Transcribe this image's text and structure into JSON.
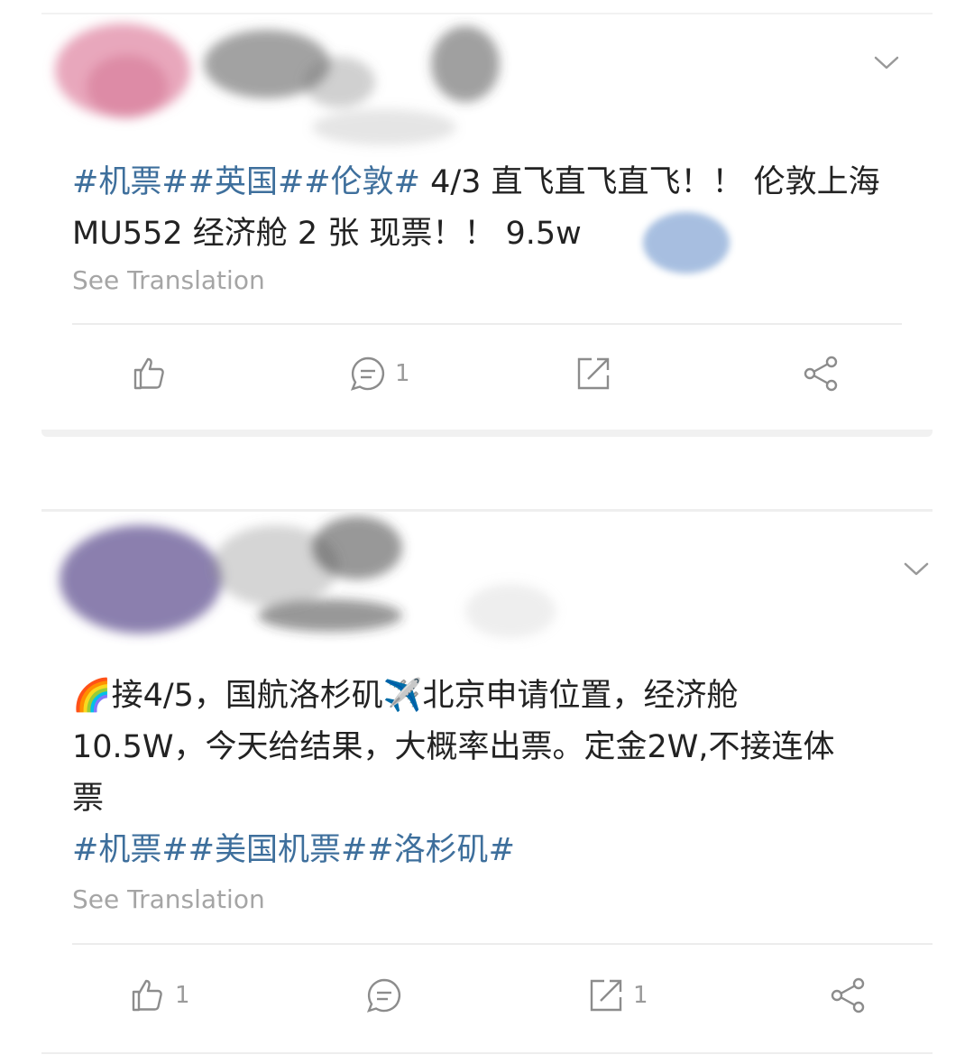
{
  "icons": {
    "chevron": "chevron-down-icon",
    "like": "thumbs-up-icon",
    "comment": "comment-bubble-icon",
    "repost": "repost-icon",
    "share": "share-icon"
  },
  "colors": {
    "hashtag": "#3e6f9c",
    "secondary": "#a5a5a5",
    "icon": "#9a9a9a"
  },
  "posts": [
    {
      "text_line1_tags": "#机票##英国##伦敦#",
      "text_line1_plain": " 4/3 直飞直飞直飞！！ 伦敦上海",
      "text_line2": "MU552 经济舱 2 张 现票！！  9.5w",
      "see_translation": "See Translation",
      "like_count": "",
      "comment_count": "1",
      "repost_count": ""
    },
    {
      "text_line1": "🌈接4/5，国航洛杉矶✈️北京申请位置，经济舱",
      "text_line2": "10.5W，今天给结果，大概率出票。定金2W,不接连体",
      "text_line3": "票",
      "tags_line": "#机票##美国机票##洛杉矶#",
      "see_translation": "See Translation",
      "like_count": "1",
      "comment_count": "",
      "repost_count": "1"
    }
  ]
}
